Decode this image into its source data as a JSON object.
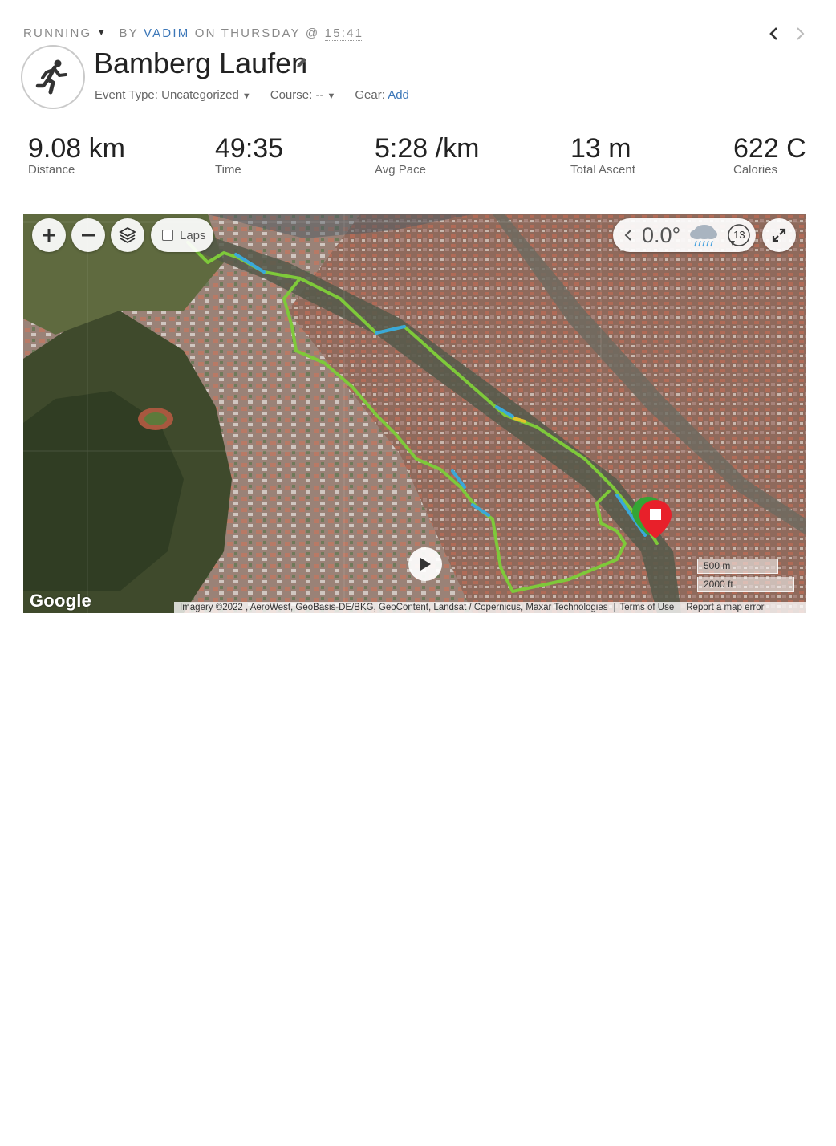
{
  "header": {
    "activity_type": "Running",
    "by_label": "by",
    "author": "Vadim",
    "on_label": "on Thursday @",
    "time": "15:41"
  },
  "activity": {
    "title": "Bamberg Laufen",
    "event_type_label": "Event Type:",
    "event_type_value": "Uncategorized",
    "course_label": "Course:",
    "course_value": "--",
    "gear_label": "Gear:",
    "gear_value": "Add"
  },
  "stats": [
    {
      "value": "9.08 km",
      "label": "Distance"
    },
    {
      "value": "49:35",
      "label": "Time"
    },
    {
      "value": "5:28 /km",
      "label": "Avg Pace"
    },
    {
      "value": "13 m",
      "label": "Total Ascent"
    },
    {
      "value": "622 C",
      "label": "Calories"
    }
  ],
  "map": {
    "laps_label": "Laps",
    "laps_checked": false,
    "weather_temp": "0.0°",
    "weather_icon": "rain-cloud-icon",
    "wind_speed": "13",
    "scale_metric": "500 m",
    "scale_imperial": "2000 ft",
    "logo_text": "Google",
    "attribution": "Imagery ©2022 , AeroWest, GeoBasis-DE/BKG, GeoContent, Landsat / Copernicus, Maxar Technologies",
    "terms_label": "Terms of Use",
    "report_label": "Report a map error",
    "route_color": "#7ec93a",
    "end_marker_color": "#e8202a",
    "start_marker_color": "#34a534"
  }
}
